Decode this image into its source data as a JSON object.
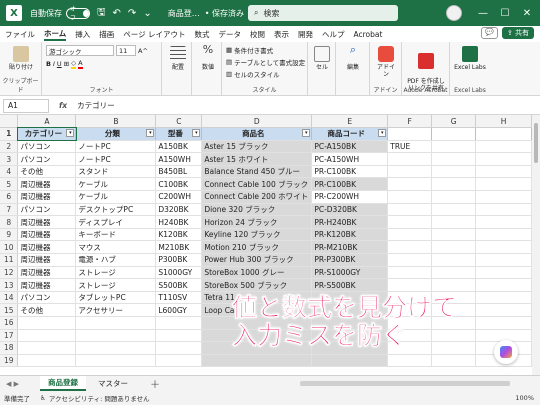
{
  "titlebar": {
    "autosave_label": "自動保存",
    "autosave_state": "オフ",
    "doc_title": "商品登…",
    "save_status": "• 保存済み",
    "search_placeholder": "検索"
  },
  "menu": {
    "tabs": [
      "ファイル",
      "ホーム",
      "挿入",
      "描画",
      "ページ レイアウト",
      "数式",
      "データ",
      "校閲",
      "表示",
      "開発",
      "ヘルプ",
      "Acrobat"
    ],
    "active": "ホーム",
    "share_label": "共有"
  },
  "ribbon": {
    "paste_label": "貼り付け",
    "clipboard_label": "クリップボード",
    "font_name": "游ゴシック",
    "font_size": "11",
    "font_group_label": "フォント",
    "align_label": "配置",
    "number_label": "数値",
    "cond_format_label": "条件付き書式",
    "table_format_label": "テーブルとして書式設定",
    "cell_style_label": "セルのスタイル",
    "style_label": "スタイル",
    "cells_label": "セル",
    "edit_label": "編集",
    "addin_label": "アドイン",
    "addin_group_label": "アドイン",
    "pdf_label": "PDF を作成し\nリンクを共有",
    "acrobat_group_label": "Adobe Acrobat",
    "excel_labs_label": "Excel Labs",
    "excel_labs_group_label": "Excel Labs"
  },
  "formula_bar": {
    "cell_ref": "A1",
    "fx": "fx",
    "content": "カテゴリー"
  },
  "columns": [
    "A",
    "B",
    "C",
    "D",
    "E",
    "F",
    "G",
    "H"
  ],
  "header_row": [
    "カテゴリー",
    "分類",
    "型番",
    "商品名",
    "商品コード"
  ],
  "rows": [
    [
      "パソコン",
      "ノートPC",
      "A150BK",
      "Aster 15 ブラック",
      "PC-A150BK",
      "TRUE"
    ],
    [
      "パソコン",
      "ノートPC",
      "A150WH",
      "Aster 15 ホワイト",
      "PC-A150WH",
      ""
    ],
    [
      "その他",
      "スタンド",
      "B450BL",
      "Balance Stand 450 ブルー",
      "PR-C100BK",
      ""
    ],
    [
      "周辺機器",
      "ケーブル",
      "C100BK",
      "Connect Cable 100 ブラック",
      "PR-C100BK",
      ""
    ],
    [
      "周辺機器",
      "ケーブル",
      "C200WH",
      "Connect Cable 200 ホワイト",
      "PR-C200WH",
      ""
    ],
    [
      "パソコン",
      "デスクトップPC",
      "D320BK",
      "Dione 320 ブラック",
      "PC-D320BK",
      ""
    ],
    [
      "周辺機器",
      "ディスプレイ",
      "H240BK",
      "Horizon 24 ブラック",
      "PR-H240BK",
      ""
    ],
    [
      "周辺機器",
      "キーボード",
      "K120BK",
      "Keyline 120 ブラック",
      "PR-K120BK",
      ""
    ],
    [
      "周辺機器",
      "マウス",
      "M210BK",
      "Motion 210 ブラック",
      "PR-M210BK",
      ""
    ],
    [
      "周辺機器",
      "電源・ハブ",
      "P300BK",
      "Power Hub 300 ブラック",
      "PR-P300BK",
      ""
    ],
    [
      "周辺機器",
      "ストレージ",
      "S1000GY",
      "StoreBox 1000 グレー",
      "PR-S1000GY",
      ""
    ],
    [
      "周辺機器",
      "ストレージ",
      "S500BK",
      "StoreBox 500 ブラック",
      "PR-S500BK",
      ""
    ],
    [
      "パソコン",
      "タブレットPC",
      "T110SV",
      "Tetra 11",
      "",
      ""
    ],
    [
      "その他",
      "アクセサリー",
      "L600GY",
      "Loop Ca",
      "",
      ""
    ],
    [
      "",
      "",
      "",
      "",
      "",
      ""
    ],
    [
      "",
      "",
      "",
      "",
      "",
      ""
    ],
    [
      "",
      "",
      "",
      "",
      "",
      ""
    ],
    [
      "",
      "",
      "",
      "",
      "",
      ""
    ]
  ],
  "sheets": [
    "商品登録",
    "マスター"
  ],
  "active_sheet": "商品登録",
  "status": {
    "ready": "準備完了",
    "accessibility": "アクセシビリティ: 問題ありません",
    "zoom": "100%"
  },
  "overlay": {
    "line1": "値と数式を見分けて",
    "line2": "入力ミスを防ぐ"
  },
  "colors": {
    "excel_green": "#1e7145",
    "header_blue": "#c9dcf0",
    "overlay_pink": "#e9175c",
    "formula_gray": "#d9d9d9"
  }
}
